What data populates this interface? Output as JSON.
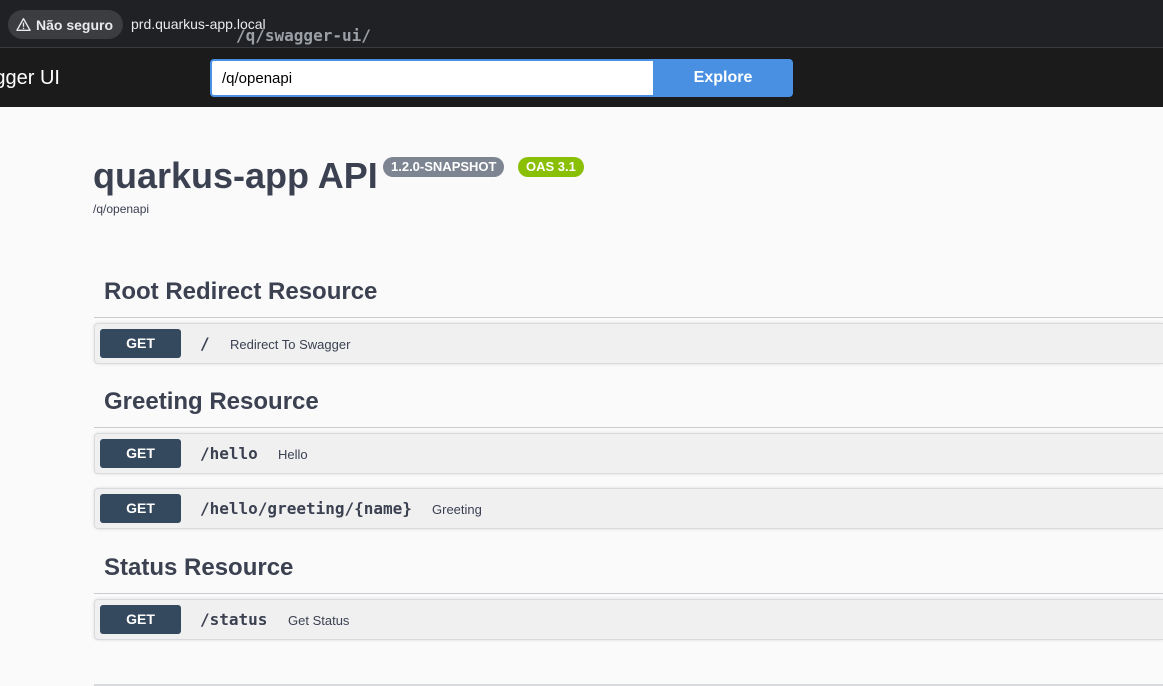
{
  "browser": {
    "security_label": "Não seguro",
    "url_host": "prd.quarkus-app.local",
    "url_path": "/q/swagger-ui/"
  },
  "topbar": {
    "title": "Swagger UI",
    "spec_url_value": "/q/openapi",
    "explore_label": "Explore"
  },
  "info": {
    "title": "quarkus-app API",
    "version_badge": "1.2.0-SNAPSHOT",
    "oas_badge": "OAS 3.1",
    "spec_link": "/q/openapi"
  },
  "tags": [
    {
      "name": "Root Redirect Resource",
      "operations": [
        {
          "method": "GET",
          "path": "/",
          "summary": "Redirect To Swagger"
        }
      ]
    },
    {
      "name": "Greeting Resource",
      "operations": [
        {
          "method": "GET",
          "path": "/hello",
          "summary": "Hello"
        },
        {
          "method": "GET",
          "path": "/hello/greeting/{name}",
          "summary": "Greeting"
        }
      ]
    },
    {
      "name": "Status Resource",
      "operations": [
        {
          "method": "GET",
          "path": "/status",
          "summary": "Get Status"
        }
      ]
    }
  ],
  "colors": {
    "get_method": "#34495e",
    "explore_button": "#4990e2",
    "version_badge": "#7d8492",
    "oas_badge": "#89bf04"
  }
}
